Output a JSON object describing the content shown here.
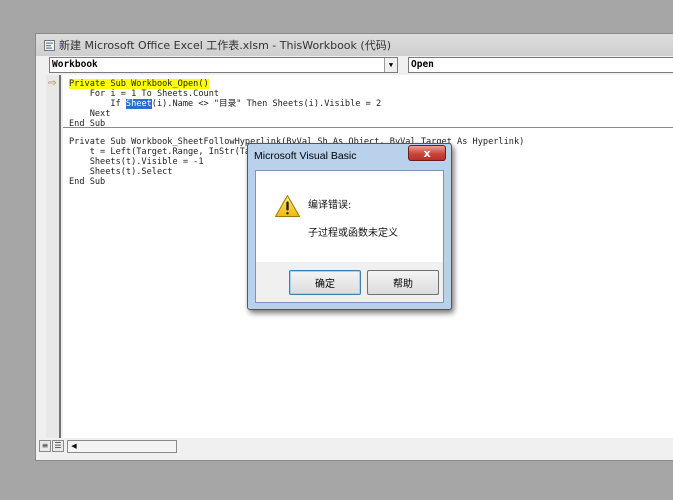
{
  "window": {
    "title": "新建 Microsoft Office Excel 工作表.xlsm - ThisWorkbook (代码)"
  },
  "object_combo": {
    "value": "Workbook"
  },
  "procedure_combo": {
    "value": "Open"
  },
  "code": {
    "l1": "Private Sub Workbook_Open()",
    "l2": "    For i = 1 To Sheets.Count",
    "l3a": "        If ",
    "l3sel": "Sheet",
    "l3b": "(i).Name <> \"目录\" Then Sheets(i).Visible = 2",
    "l4": "    Next",
    "l5": "End Sub",
    "l6": "Private Sub Workbook_SheetFollowHyperlink(ByVal Sh As Object, ByVal Target As Hyperlink)",
    "l7": "    t = Left(Target.Range, InStr(Target.",
    "l8": "    Sheets(t).Visible = -1",
    "l9": "    Sheets(t).Select",
    "l10": "End Sub"
  },
  "dialog": {
    "title": "Microsoft Visual Basic",
    "close_label": "x",
    "message_title": "编译错误:",
    "message_body": "子过程或函数未定义",
    "ok_label": "确定",
    "help_label": "帮助"
  },
  "icons": {
    "app": "vba-app-icon",
    "warning": "warning-icon",
    "exec_pointer": "execution-arrow-icon"
  },
  "colors": {
    "highlight": "#ffff00",
    "selection": "#2a6fcf",
    "dialog_frame": "#b9d1ea",
    "close_button": "#c9453a"
  }
}
